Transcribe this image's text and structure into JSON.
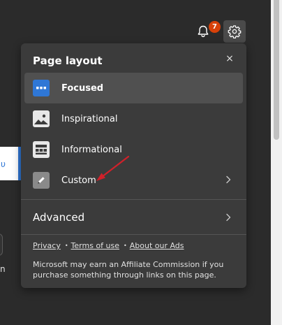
{
  "header": {
    "notification_count": "7",
    "bell_icon": "bell-icon",
    "settings_icon": "gear-icon"
  },
  "background": {
    "card_glyph": "υ",
    "side_letter": "n"
  },
  "panel": {
    "title": "Page layout",
    "close_glyph": "×",
    "layouts": [
      {
        "label": "Focused",
        "icon": "focused-layout-icon",
        "selected": true
      },
      {
        "label": "Inspirational",
        "icon": "image-layout-icon",
        "selected": false
      },
      {
        "label": "Informational",
        "icon": "grid-layout-icon",
        "selected": false
      },
      {
        "label": "Custom",
        "icon": "pencil-icon",
        "selected": false
      }
    ],
    "advanced_label": "Advanced",
    "links": {
      "privacy": "Privacy",
      "terms": "Terms of use",
      "ads": "About our Ads",
      "separator": "•"
    },
    "disclaimer": "Microsoft may earn an Affiliate Commission if you purchase something through links on this page."
  },
  "colors": {
    "background": "#2b2b2b",
    "panel": "#3b3b3b",
    "selected_row": "#505050",
    "accent": "#2f77d6",
    "badge": "#d74109",
    "annotation_arrow": "#d0212a"
  }
}
